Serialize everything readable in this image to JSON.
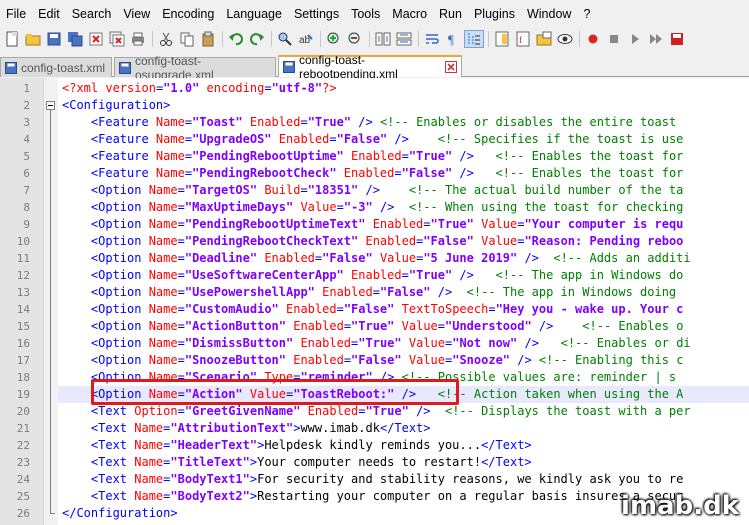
{
  "menu": [
    "File",
    "Edit",
    "Search",
    "View",
    "Encoding",
    "Language",
    "Settings",
    "Tools",
    "Macro",
    "Run",
    "Plugins",
    "Window",
    "?"
  ],
  "toolbar_icons": [
    "new-file-icon",
    "open-file-icon",
    "save-icon",
    "save-all-icon",
    "close-icon",
    "close-all-icon",
    "print-icon",
    "cut-icon",
    "copy-icon",
    "paste-icon",
    "undo-icon",
    "redo-icon",
    "find-icon",
    "replace-icon",
    "zoom-in-icon",
    "zoom-out-icon",
    "sync-vertical-icon",
    "sync-horizontal-icon",
    "word-wrap-icon",
    "show-all-chars-icon",
    "indent-guide-icon",
    "doc-map-icon",
    "function-list-icon",
    "folder-workspace-icon",
    "monitoring-icon",
    "record-macro-icon",
    "stop-macro-icon",
    "play-macro-icon",
    "run-macro-multiple-icon",
    "save-macro-icon"
  ],
  "tabs": [
    {
      "label": "config-toast.xml",
      "active": false
    },
    {
      "label": "config-toast-osupgrade.xml",
      "active": false
    },
    {
      "label": "config-toast-rebootpending.xml",
      "active": true
    }
  ],
  "colors": {
    "tag": "#0000ff",
    "attr": "#ff0000",
    "value": "#8000ff",
    "comment": "#008000",
    "highlight": "#e01a1a",
    "tab_accent": "#f3a738"
  },
  "lines": [
    {
      "n": "1",
      "segs": [
        [
          "decl",
          "<?xml "
        ],
        [
          "attr",
          "version"
        ],
        [
          "tag",
          "="
        ],
        [
          "val",
          "\"1.0\""
        ],
        [
          "tag",
          " "
        ],
        [
          "attr",
          "encoding"
        ],
        [
          "tag",
          "="
        ],
        [
          "val",
          "\"utf-8\""
        ],
        [
          "decl",
          "?>"
        ]
      ]
    },
    {
      "n": "2",
      "segs": [
        [
          "tag",
          "<Configuration>"
        ]
      ]
    },
    {
      "n": "3",
      "segs": [
        [
          "tag",
          "    <Feature "
        ],
        [
          "attr",
          "Name"
        ],
        [
          "tag",
          "="
        ],
        [
          "val",
          "\"Toast\""
        ],
        [
          "tag",
          " "
        ],
        [
          "attr",
          "Enabled"
        ],
        [
          "tag",
          "="
        ],
        [
          "val",
          "\"True\""
        ],
        [
          "tag",
          " /> "
        ],
        [
          "com",
          "<!-- Enables or disables the entire toast"
        ]
      ]
    },
    {
      "n": "4",
      "segs": [
        [
          "tag",
          "    <Feature "
        ],
        [
          "attr",
          "Name"
        ],
        [
          "tag",
          "="
        ],
        [
          "val",
          "\"UpgradeOS\""
        ],
        [
          "tag",
          " "
        ],
        [
          "attr",
          "Enabled"
        ],
        [
          "tag",
          "="
        ],
        [
          "val",
          "\"False\""
        ],
        [
          "tag",
          " />    "
        ],
        [
          "com",
          "<!-- Specifies if the toast is use"
        ]
      ]
    },
    {
      "n": "5",
      "segs": [
        [
          "tag",
          "    <Feature "
        ],
        [
          "attr",
          "Name"
        ],
        [
          "tag",
          "="
        ],
        [
          "val",
          "\"PendingRebootUptime\""
        ],
        [
          "tag",
          " "
        ],
        [
          "attr",
          "Enabled"
        ],
        [
          "tag",
          "="
        ],
        [
          "val",
          "\"True\""
        ],
        [
          "tag",
          " />   "
        ],
        [
          "com",
          "<!-- Enables the toast for"
        ]
      ]
    },
    {
      "n": "6",
      "segs": [
        [
          "tag",
          "    <Feature "
        ],
        [
          "attr",
          "Name"
        ],
        [
          "tag",
          "="
        ],
        [
          "val",
          "\"PendingRebootCheck\""
        ],
        [
          "tag",
          " "
        ],
        [
          "attr",
          "Enabled"
        ],
        [
          "tag",
          "="
        ],
        [
          "val",
          "\"False\""
        ],
        [
          "tag",
          " />   "
        ],
        [
          "com",
          "<!-- Enables the toast for"
        ]
      ]
    },
    {
      "n": "7",
      "segs": [
        [
          "tag",
          "    <Option "
        ],
        [
          "attr",
          "Name"
        ],
        [
          "tag",
          "="
        ],
        [
          "val",
          "\"TargetOS\""
        ],
        [
          "tag",
          " "
        ],
        [
          "attr",
          "Build"
        ],
        [
          "tag",
          "="
        ],
        [
          "val",
          "\"18351\""
        ],
        [
          "tag",
          " />    "
        ],
        [
          "com",
          "<!-- The actual build number of the ta"
        ]
      ]
    },
    {
      "n": "8",
      "segs": [
        [
          "tag",
          "    <Option "
        ],
        [
          "attr",
          "Name"
        ],
        [
          "tag",
          "="
        ],
        [
          "val",
          "\"MaxUptimeDays\""
        ],
        [
          "tag",
          " "
        ],
        [
          "attr",
          "Value"
        ],
        [
          "tag",
          "="
        ],
        [
          "val",
          "\"-3\""
        ],
        [
          "tag",
          " />  "
        ],
        [
          "com",
          "<!-- When using the toast for checking"
        ]
      ]
    },
    {
      "n": "9",
      "segs": [
        [
          "tag",
          "    <Option "
        ],
        [
          "attr",
          "Name"
        ],
        [
          "tag",
          "="
        ],
        [
          "val",
          "\"PendingRebootUptimeText\""
        ],
        [
          "tag",
          " "
        ],
        [
          "attr",
          "Enabled"
        ],
        [
          "tag",
          "="
        ],
        [
          "val",
          "\"True\""
        ],
        [
          "tag",
          " "
        ],
        [
          "attr",
          "Value"
        ],
        [
          "tag",
          "="
        ],
        [
          "val",
          "\"Your computer is requ"
        ]
      ]
    },
    {
      "n": "10",
      "segs": [
        [
          "tag",
          "    <Option "
        ],
        [
          "attr",
          "Name"
        ],
        [
          "tag",
          "="
        ],
        [
          "val",
          "\"PendingRebootCheckText\""
        ],
        [
          "tag",
          " "
        ],
        [
          "attr",
          "Enabled"
        ],
        [
          "tag",
          "="
        ],
        [
          "val",
          "\"False\""
        ],
        [
          "tag",
          " "
        ],
        [
          "attr",
          "Value"
        ],
        [
          "tag",
          "="
        ],
        [
          "val",
          "\"Reason: Pending reboo"
        ]
      ]
    },
    {
      "n": "11",
      "segs": [
        [
          "tag",
          "    <Option "
        ],
        [
          "attr",
          "Name"
        ],
        [
          "tag",
          "="
        ],
        [
          "val",
          "\"Deadline\""
        ],
        [
          "tag",
          " "
        ],
        [
          "attr",
          "Enabled"
        ],
        [
          "tag",
          "="
        ],
        [
          "val",
          "\"False\""
        ],
        [
          "tag",
          " "
        ],
        [
          "attr",
          "Value"
        ],
        [
          "tag",
          "="
        ],
        [
          "val",
          "\"5 June 2019\""
        ],
        [
          "tag",
          " />  "
        ],
        [
          "com",
          "<!-- Adds an additi"
        ]
      ]
    },
    {
      "n": "12",
      "segs": [
        [
          "tag",
          "    <Option "
        ],
        [
          "attr",
          "Name"
        ],
        [
          "tag",
          "="
        ],
        [
          "val",
          "\"UseSoftwareCenterApp\""
        ],
        [
          "tag",
          " "
        ],
        [
          "attr",
          "Enabled"
        ],
        [
          "tag",
          "="
        ],
        [
          "val",
          "\"True\""
        ],
        [
          "tag",
          " />   "
        ],
        [
          "com",
          "<!-- The app in Windows do"
        ]
      ]
    },
    {
      "n": "13",
      "segs": [
        [
          "tag",
          "    <Option "
        ],
        [
          "attr",
          "Name"
        ],
        [
          "tag",
          "="
        ],
        [
          "val",
          "\"UsePowershellApp\""
        ],
        [
          "tag",
          " "
        ],
        [
          "attr",
          "Enabled"
        ],
        [
          "tag",
          "="
        ],
        [
          "val",
          "\"False\""
        ],
        [
          "tag",
          " />  "
        ],
        [
          "com",
          "<!-- The app in Windows doing"
        ]
      ]
    },
    {
      "n": "14",
      "segs": [
        [
          "tag",
          "    <Option "
        ],
        [
          "attr",
          "Name"
        ],
        [
          "tag",
          "="
        ],
        [
          "val",
          "\"CustomAudio\""
        ],
        [
          "tag",
          " "
        ],
        [
          "attr",
          "Enabled"
        ],
        [
          "tag",
          "="
        ],
        [
          "val",
          "\"False\""
        ],
        [
          "tag",
          " "
        ],
        [
          "attr",
          "TextToSpeech"
        ],
        [
          "tag",
          "="
        ],
        [
          "val",
          "\"Hey you - wake up. Your c"
        ]
      ]
    },
    {
      "n": "15",
      "segs": [
        [
          "tag",
          "    <Option "
        ],
        [
          "attr",
          "Name"
        ],
        [
          "tag",
          "="
        ],
        [
          "val",
          "\"ActionButton\""
        ],
        [
          "tag",
          " "
        ],
        [
          "attr",
          "Enabled"
        ],
        [
          "tag",
          "="
        ],
        [
          "val",
          "\"True\""
        ],
        [
          "tag",
          " "
        ],
        [
          "attr",
          "Value"
        ],
        [
          "tag",
          "="
        ],
        [
          "val",
          "\"Understood\""
        ],
        [
          "tag",
          " />    "
        ],
        [
          "com",
          "<!-- Enables o"
        ]
      ]
    },
    {
      "n": "16",
      "segs": [
        [
          "tag",
          "    <Option "
        ],
        [
          "attr",
          "Name"
        ],
        [
          "tag",
          "="
        ],
        [
          "val",
          "\"DismissButton\""
        ],
        [
          "tag",
          " "
        ],
        [
          "attr",
          "Enabled"
        ],
        [
          "tag",
          "="
        ],
        [
          "val",
          "\"True\""
        ],
        [
          "tag",
          " "
        ],
        [
          "attr",
          "Value"
        ],
        [
          "tag",
          "="
        ],
        [
          "val",
          "\"Not now\""
        ],
        [
          "tag",
          " />   "
        ],
        [
          "com",
          "<!-- Enables or di"
        ]
      ]
    },
    {
      "n": "17",
      "segs": [
        [
          "tag",
          "    <Option "
        ],
        [
          "attr",
          "Name"
        ],
        [
          "tag",
          "="
        ],
        [
          "val",
          "\"SnoozeButton\""
        ],
        [
          "tag",
          " "
        ],
        [
          "attr",
          "Enabled"
        ],
        [
          "tag",
          "="
        ],
        [
          "val",
          "\"False\""
        ],
        [
          "tag",
          " "
        ],
        [
          "attr",
          "Value"
        ],
        [
          "tag",
          "="
        ],
        [
          "val",
          "\"Snooze\""
        ],
        [
          "tag",
          " /> "
        ],
        [
          "com",
          "<!-- Enabling this c"
        ]
      ]
    },
    {
      "n": "18",
      "segs": [
        [
          "tag",
          "    <Option "
        ],
        [
          "attr",
          "Name"
        ],
        [
          "tag",
          "="
        ],
        [
          "val",
          "\"Scenario\""
        ],
        [
          "tag",
          " "
        ],
        [
          "attr",
          "Type"
        ],
        [
          "tag",
          "="
        ],
        [
          "val",
          "\"reminder\""
        ],
        [
          "tag",
          " /> "
        ],
        [
          "com",
          "<!-- Possible values are: reminder | s"
        ]
      ]
    },
    {
      "n": "19",
      "segs": [
        [
          "tag",
          "    <Option "
        ],
        [
          "attr",
          "Name"
        ],
        [
          "tag",
          "="
        ],
        [
          "val",
          "\"Action\""
        ],
        [
          "tag",
          " "
        ],
        [
          "attr",
          "Value"
        ],
        [
          "tag",
          "="
        ],
        [
          "val",
          "\"ToastReboot:\""
        ],
        [
          "tag",
          " />   "
        ],
        [
          "com",
          "<!-- Action taken when using the A"
        ]
      ]
    },
    {
      "n": "20",
      "segs": [
        [
          "tag",
          "    <Text "
        ],
        [
          "attr",
          "Option"
        ],
        [
          "tag",
          "="
        ],
        [
          "val",
          "\"GreetGivenName\""
        ],
        [
          "tag",
          " "
        ],
        [
          "attr",
          "Enabled"
        ],
        [
          "tag",
          "="
        ],
        [
          "val",
          "\"True\""
        ],
        [
          "tag",
          " />  "
        ],
        [
          "com",
          "<!-- Displays the toast with a per"
        ]
      ]
    },
    {
      "n": "21",
      "segs": [
        [
          "tag",
          "    <Text "
        ],
        [
          "attr",
          "Name"
        ],
        [
          "tag",
          "="
        ],
        [
          "val",
          "\"AttributionText\""
        ],
        [
          "tag",
          ">"
        ],
        [
          "txt",
          "www.imab.dk"
        ],
        [
          "tag",
          "</Text>"
        ]
      ]
    },
    {
      "n": "22",
      "segs": [
        [
          "tag",
          "    <Text "
        ],
        [
          "attr",
          "Name"
        ],
        [
          "tag",
          "="
        ],
        [
          "val",
          "\"HeaderText\""
        ],
        [
          "tag",
          ">"
        ],
        [
          "txt",
          "Helpdesk kindly reminds you..."
        ],
        [
          "tag",
          "</Text>"
        ]
      ]
    },
    {
      "n": "23",
      "segs": [
        [
          "tag",
          "    <Text "
        ],
        [
          "attr",
          "Name"
        ],
        [
          "tag",
          "="
        ],
        [
          "val",
          "\"TitleText\""
        ],
        [
          "tag",
          ">"
        ],
        [
          "txt",
          "Your computer needs to restart!"
        ],
        [
          "tag",
          "</Text>"
        ]
      ]
    },
    {
      "n": "24",
      "segs": [
        [
          "tag",
          "    <Text "
        ],
        [
          "attr",
          "Name"
        ],
        [
          "tag",
          "="
        ],
        [
          "val",
          "\"BodyText1\""
        ],
        [
          "tag",
          ">"
        ],
        [
          "txt",
          "For security and stability reasons, we kindly ask you to re"
        ]
      ]
    },
    {
      "n": "25",
      "segs": [
        [
          "tag",
          "    <Text "
        ],
        [
          "attr",
          "Name"
        ],
        [
          "tag",
          "="
        ],
        [
          "val",
          "\"BodyText2\""
        ],
        [
          "tag",
          ">"
        ],
        [
          "txt",
          "Restarting your computer on a regular basis insures a secur"
        ]
      ]
    },
    {
      "n": "26",
      "segs": [
        [
          "tag",
          "</Configuration>"
        ]
      ]
    }
  ],
  "watermark": "imab.dk"
}
